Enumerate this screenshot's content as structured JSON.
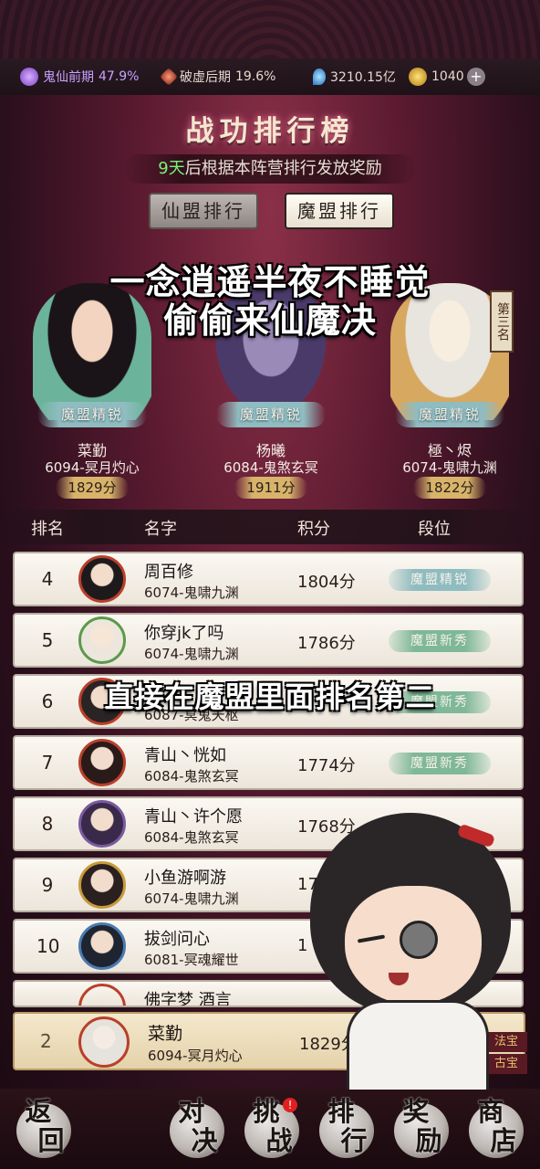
{
  "status_bar": {
    "realm_label": "鬼仙前期",
    "realm_progress": "47.9%",
    "stage_label": "破虚后期",
    "stage_progress": "19.6%",
    "spirit_stones": "3210.15亿",
    "coins": "1040",
    "plus": "+"
  },
  "title": "战功排行榜",
  "subtitle": {
    "days": "9天",
    "text": "后根据本阵营排行发放奖励"
  },
  "tabs": [
    "仙盟排行",
    "魔盟排行"
  ],
  "captions": {
    "line1": "一念逍遥半夜不睡觉",
    "line2": "偷偷来仙魔决",
    "line3": "直接在魔盟里面排名第二"
  },
  "podium": [
    {
      "name": "菜勤",
      "server": "6094-冥月灼心",
      "score": "1829分",
      "tier": "魔盟精锐"
    },
    {
      "name": "杨曦",
      "server": "6084-鬼煞玄冥",
      "score": "1911分",
      "tier": "魔盟精锐"
    },
    {
      "name": "極丶烬",
      "server": "6074-鬼啸九渊",
      "score": "1822分",
      "tier": "魔盟精锐",
      "rank_tag": "第三名"
    }
  ],
  "table_header": {
    "rank": "排名",
    "name": "名字",
    "score": "积分",
    "tier": "段位"
  },
  "rows": [
    {
      "rank": "4",
      "name": "周百修",
      "server": "6074-鬼啸九渊",
      "score": "1804分",
      "tier": "魔盟精锐"
    },
    {
      "rank": "5",
      "name": "你穿jk了吗",
      "server": "6074-鬼啸九渊",
      "score": "1786分",
      "tier": "魔盟新秀"
    },
    {
      "rank": "6",
      "name": "",
      "server": "6087-冥鬼天枢",
      "score": "",
      "tier": "魔盟新秀"
    },
    {
      "rank": "7",
      "name": "青山丶恍如",
      "server": "6084-鬼煞玄冥",
      "score": "1774分",
      "tier": "魔盟新秀"
    },
    {
      "rank": "8",
      "name": "青山丶许个愿",
      "server": "6084-鬼煞玄冥",
      "score": "1768分",
      "tier": ""
    },
    {
      "rank": "9",
      "name": "小鱼游啊游",
      "server": "6074-鬼啸九渊",
      "score": "176",
      "tier": ""
    },
    {
      "rank": "10",
      "name": "拔剑问心",
      "server": "6081-冥魂耀世",
      "score": "1",
      "tier": ""
    },
    {
      "rank": "",
      "name": "佛字梦 酒言",
      "server": "",
      "score": "",
      "tier": ""
    }
  ],
  "self": {
    "rank": "2",
    "name": "菜勤",
    "server": "6094-冥月灼心",
    "score": "1829分",
    "side_tabs": [
      "法宝",
      "古宝"
    ]
  },
  "bottom_nav": [
    {
      "label1": "返",
      "label2": "回"
    },
    {
      "label1": "对",
      "label2": "决"
    },
    {
      "label1": "挑",
      "label2": "战",
      "alert": "!"
    },
    {
      "label1": "排",
      "label2": "行"
    },
    {
      "label1": "奖",
      "label2": "励"
    },
    {
      "label1": "商",
      "label2": "店"
    }
  ],
  "colors": {
    "accent_green": "#7df07a",
    "realm_purple": "#c9a0ff",
    "tier_elite": "#8fbcc0",
    "tier_new": "#7fb898",
    "alert_red": "#e02020"
  }
}
